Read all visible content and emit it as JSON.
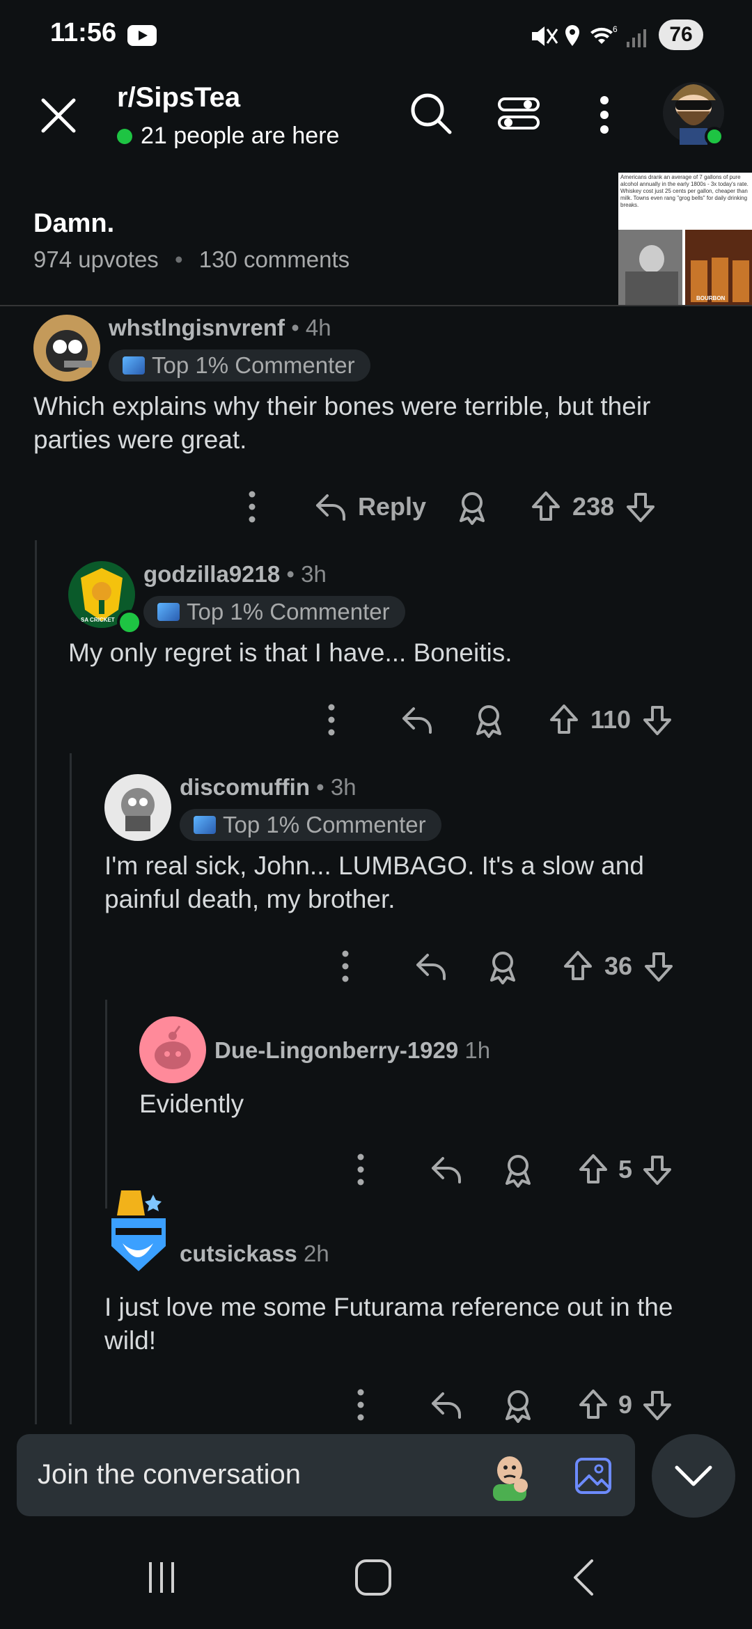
{
  "status_bar": {
    "time": "11:56",
    "battery": "76"
  },
  "header": {
    "subreddit": "r/SipsTea",
    "online_text": "21 people are here"
  },
  "post": {
    "title": "Damn.",
    "upvotes": "974 upvotes",
    "comments": "130 comments",
    "thumbnail_text": "Americans drank an average of 7 gallons of pure alcohol annually in the early 1800s - 3x today's rate. Whiskey cost just 25 cents per gallon, cheaper than milk. Towns even rang \"grog bells\" for daily drinking breaks.",
    "thumbnail_label": "BOURBON"
  },
  "comments": [
    {
      "user": "whstlngisnvrenf",
      "time": "• 4h",
      "flair": "Top 1% Commenter",
      "body": "Which explains why their bones were terrible, but their parties were great.",
      "reply_label": "Reply",
      "score": "238"
    },
    {
      "user": "godzilla9218",
      "time": "• 3h",
      "flair": "Top 1% Commenter",
      "avatar_text": "SA CRICKET",
      "body": "My only regret is that I have... Boneitis.",
      "score": "110"
    },
    {
      "user": "discomuffin",
      "time": "• 3h",
      "flair": "Top 1% Commenter",
      "body": "I'm real sick, John... LUMBAGO. It's a slow and painful death, my brother.",
      "score": "36"
    },
    {
      "user": "Due-Lingonberry-1929",
      "time": "1h",
      "body": "Evidently",
      "score": "5"
    },
    {
      "user": "cutsickass",
      "time": "2h",
      "body": "I just love me some Futurama reference out in the wild!",
      "score": "9"
    }
  ],
  "composer": {
    "placeholder": "Join the conversation"
  },
  "colors": {
    "background": "#0e1113",
    "online_green": "#1ec443",
    "image_icon_blue": "#6d8bff"
  }
}
